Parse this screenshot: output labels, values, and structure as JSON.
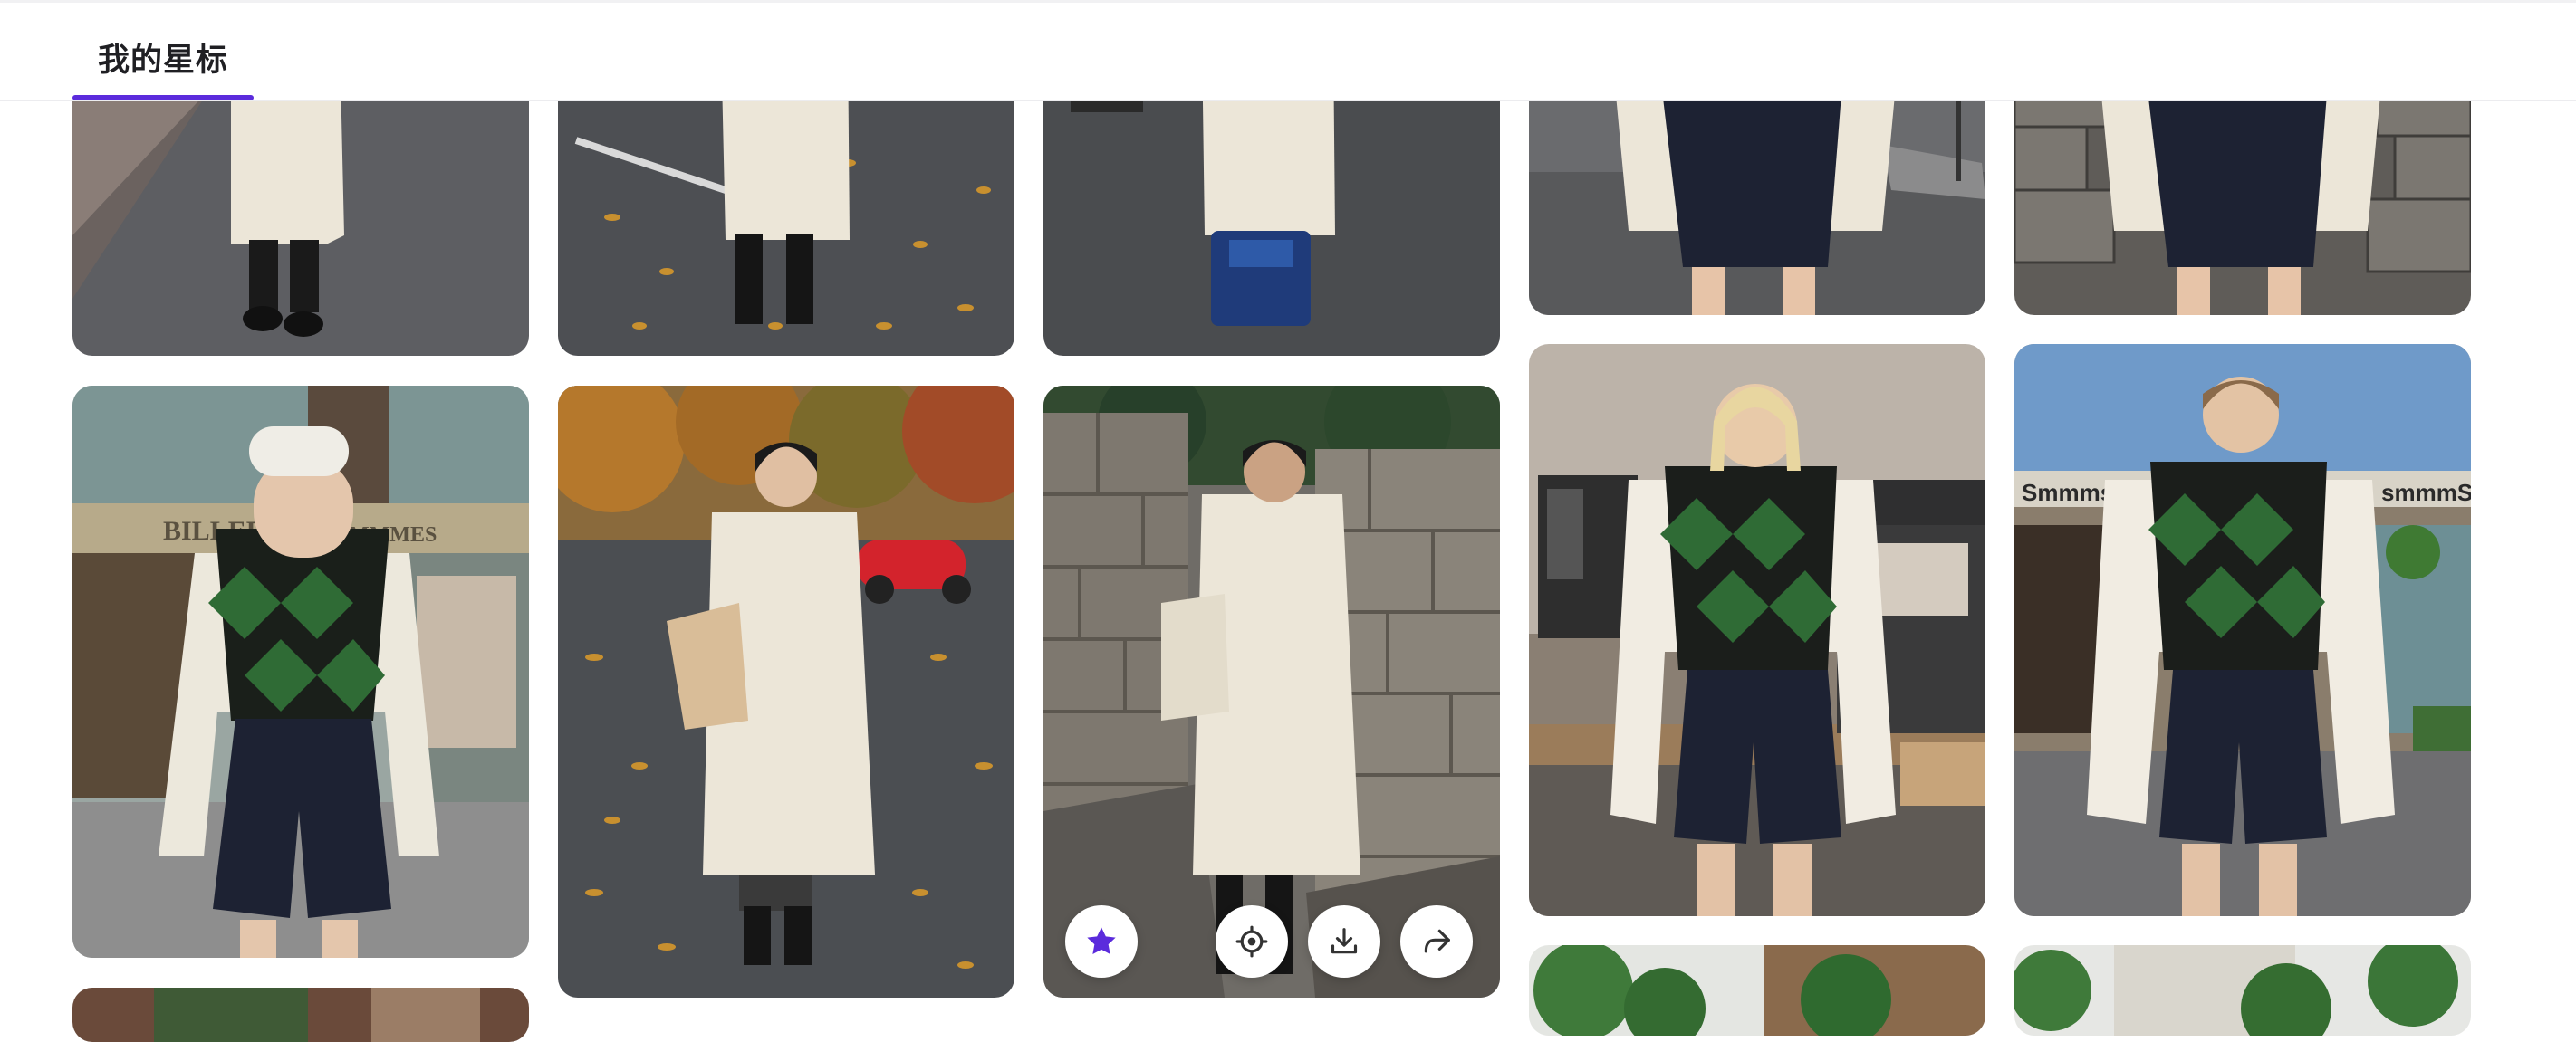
{
  "header": {
    "tab_label": "我的星标",
    "accent_color": "#5b2bdc"
  },
  "gallery": {
    "hovered_card_actions": [
      {
        "icon": "star-icon",
        "state": "starred"
      },
      {
        "icon": "locate-icon"
      },
      {
        "icon": "download-icon"
      },
      {
        "icon": "share-icon"
      }
    ],
    "storefront_signs": [
      "BILLEE",
      "MMMES",
      "Smmms or",
      "smmmS"
    ]
  }
}
